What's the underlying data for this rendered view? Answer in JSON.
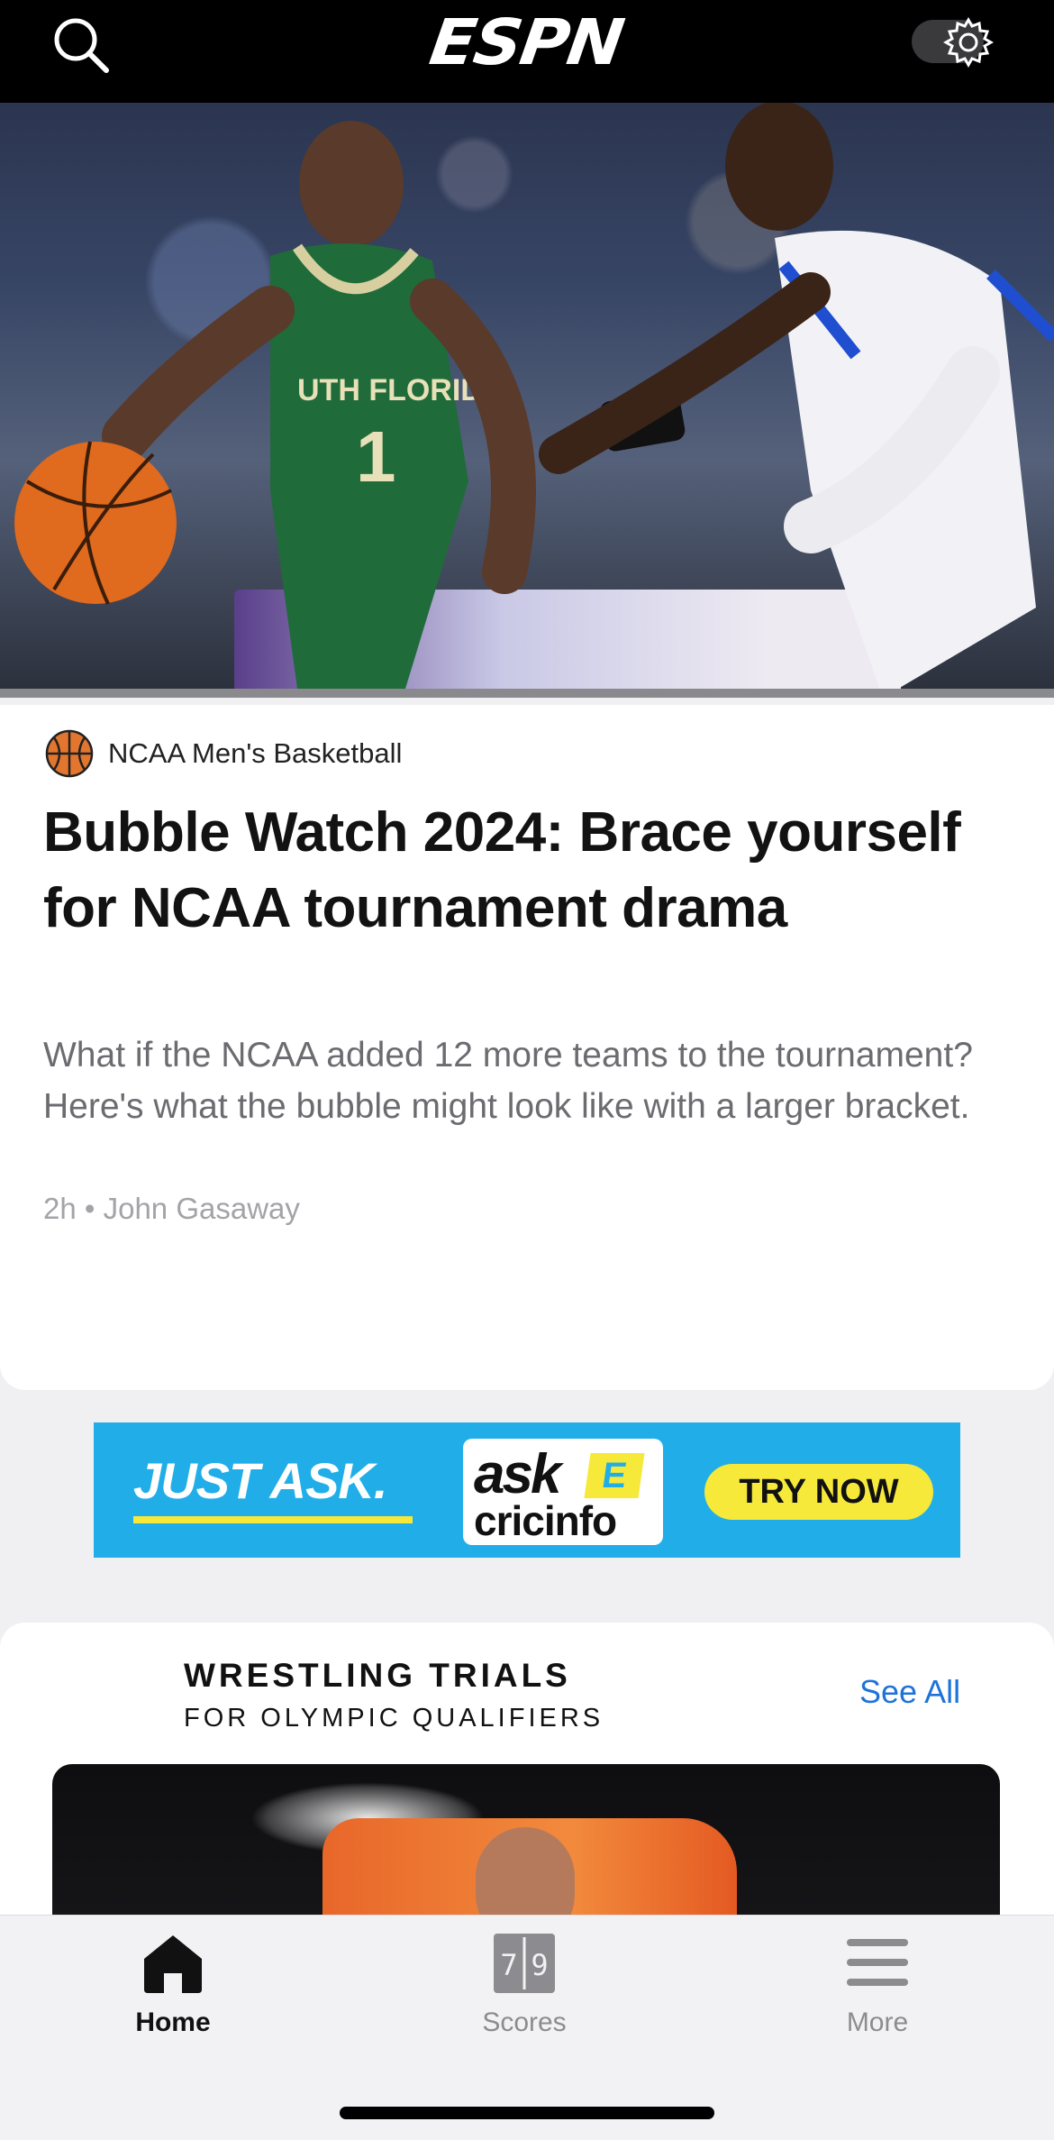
{
  "header": {
    "logo_text": "ESPN",
    "search_icon": "search-icon",
    "settings_icon": "gear-icon"
  },
  "hero": {
    "sport_label": "NCAA Men's Basketball",
    "sport_icon": "basketball-icon",
    "headline": "Bubble Watch 2024: Brace yourself for NCAA tournament drama",
    "summary": "What if the NCAA added 12 more teams to the tournament? Here's what the bubble might look like with a larger bracket.",
    "byline": "2h • John Gasaway"
  },
  "ad": {
    "tagline": "JUST ASK.",
    "brand_top": "ask",
    "brand_e": "E",
    "brand_bottom": "cricinfo",
    "cta": "TRY NOW",
    "colors": {
      "background": "#21aee8",
      "accent": "#f6e93a"
    }
  },
  "section": {
    "title": "WRESTLING TRIALS",
    "subtitle": "FOR OLYMPIC QUALIFIERS",
    "see_all": "See All"
  },
  "tabbar": {
    "items": [
      {
        "label": "Home",
        "icon": "home-icon",
        "active": true
      },
      {
        "label": "Scores",
        "icon": "scoreboard-icon",
        "active": false
      },
      {
        "label": "More",
        "icon": "menu-icon",
        "active": false
      }
    ]
  },
  "colors": {
    "link": "#1f73d8",
    "header_bg": "#000000",
    "secondary_text": "#6b6b70"
  }
}
